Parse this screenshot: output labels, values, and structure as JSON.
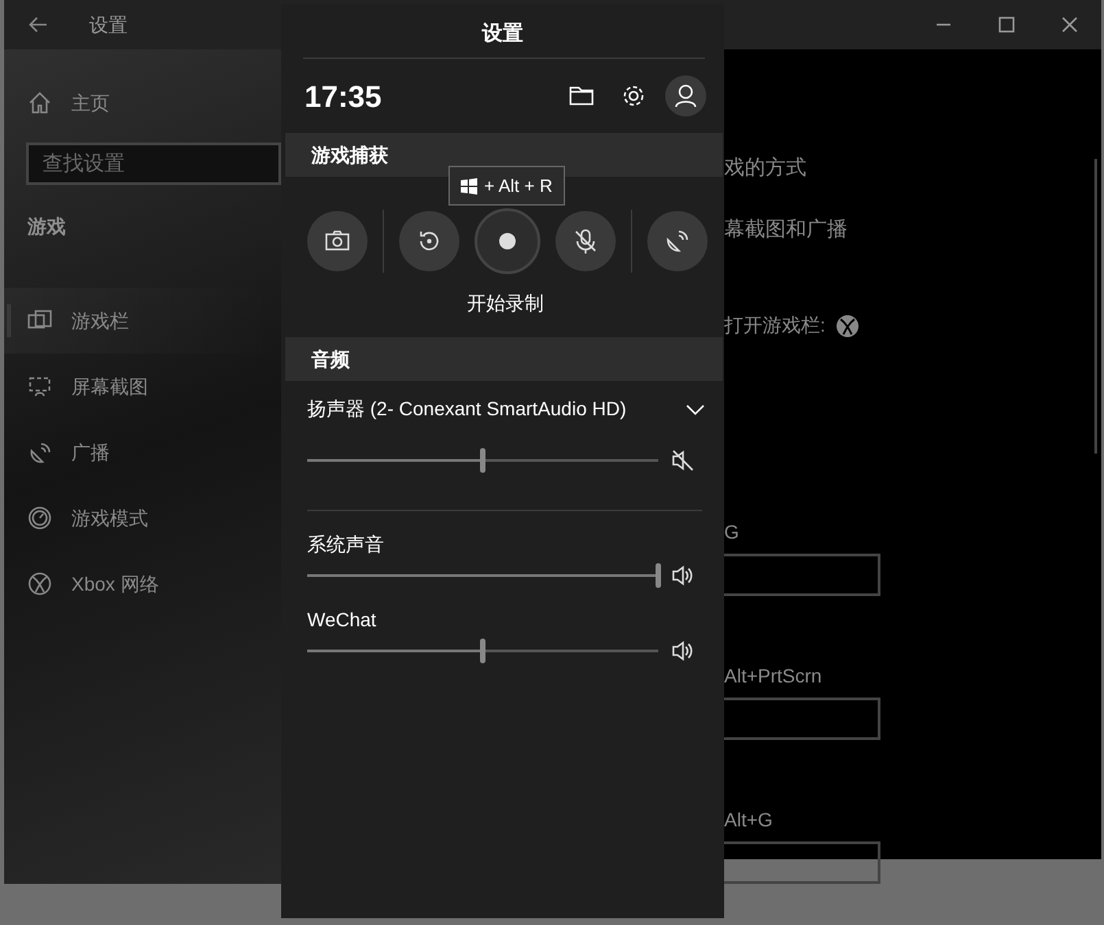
{
  "settings_window": {
    "title": "设置",
    "home": "主页",
    "search": {
      "placeholder": "查找设置"
    },
    "section": "游戏",
    "nav_items": [
      {
        "label": "游戏栏",
        "kind": "gamebar",
        "selected": true
      },
      {
        "label": "屏幕截图",
        "kind": "screenshot",
        "selected": false
      },
      {
        "label": "广播",
        "kind": "broadcast",
        "selected": false
      },
      {
        "label": "游戏模式",
        "kind": "gamemode",
        "selected": false
      },
      {
        "label": "Xbox 网络",
        "kind": "xbox",
        "selected": false
      }
    ],
    "content": {
      "text_fragments": [
        "戏的方式",
        "幕截图和广播"
      ],
      "open_with_controller": "打开游戏栏:",
      "shortcuts": [
        {
          "label": "G"
        },
        {
          "label": "Alt+PrtScrn"
        },
        {
          "label": "Alt+G"
        }
      ]
    }
  },
  "game_bar": {
    "title": "设置",
    "time": "17:35",
    "capture": {
      "title": "游戏捕获",
      "tooltip": "+ Alt + R",
      "caption": "开始录制",
      "buttons": [
        {
          "kind": "screenshot"
        },
        {
          "kind": "divider"
        },
        {
          "kind": "replay"
        },
        {
          "kind": "record"
        },
        {
          "kind": "mic",
          "muted": true
        },
        {
          "kind": "divider"
        },
        {
          "kind": "broadcast"
        }
      ]
    },
    "audio": {
      "title": "音频",
      "device": {
        "label": "扬声器 (2- Conexant SmartAudio HD)",
        "level": 0.5,
        "muted": true
      },
      "apps": [
        {
          "label": "系统声音",
          "level": 1,
          "muted": false
        },
        {
          "label": "WeChat",
          "level": 0.5,
          "muted": false
        }
      ]
    }
  }
}
